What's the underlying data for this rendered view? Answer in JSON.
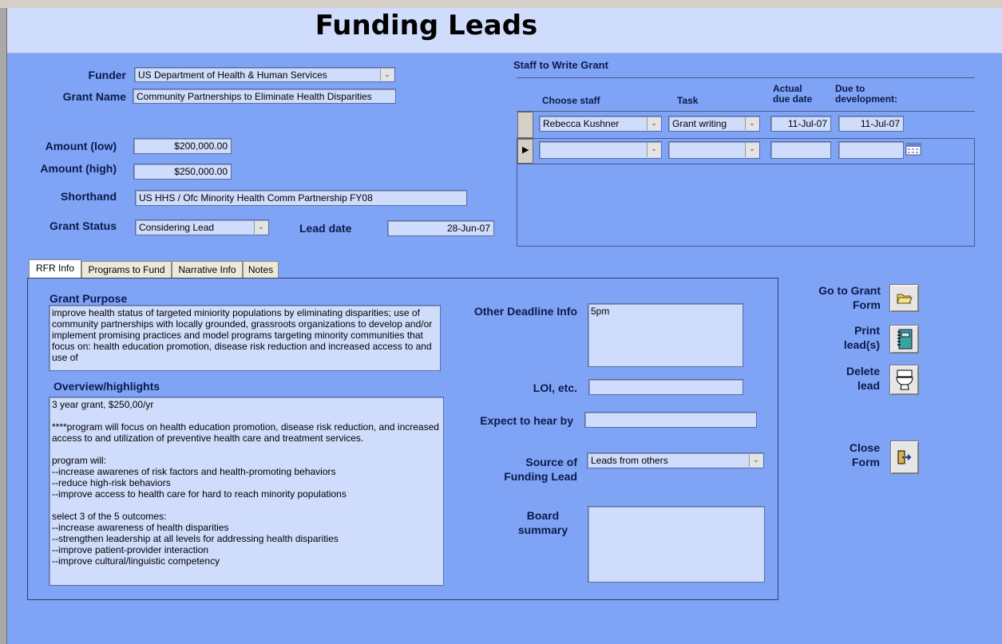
{
  "title": "Funding Leads",
  "labels": {
    "funder": "Funder",
    "grant_name": "Grant Name",
    "amount_low": "Amount (low)",
    "amount_high": "Amount (high)",
    "shorthand": "Shorthand",
    "grant_status": "Grant Status",
    "lead_date": "Lead date",
    "grant_purpose": "Grant Purpose",
    "overview": "Overview/highlights",
    "other_deadline": "Other Deadline Info",
    "loi": "LOI, etc.",
    "expect_hear": "Expect to hear by",
    "source_line1": "Source of",
    "source_line2": "Funding Lead",
    "board_line1": "Board",
    "board_line2": "summary"
  },
  "fields": {
    "funder": "US Department of Health & Human Services",
    "grant_name": "Community Partnerships to Eliminate Health Disparities",
    "amount_low": "$200,000.00",
    "amount_high": "$250,000.00",
    "shorthand": "US HHS / Ofc Minority Health Comm Partnership FY08",
    "grant_status": "Considering Lead",
    "lead_date": "28-Jun-07",
    "grant_purpose": "improve health status of targeted miniority populations by eliminating disparities; use of community partnerships with locally grounded, grassroots organizations to develop and/or implement promising practices and model programs targeting minority communities that focus on: health education promotion, disease risk reduction and increased access to and use of",
    "overview_lines": [
      "3 year grant, $250,00/yr",
      "",
      "****program will focus on health education promotion, disease risk reduction, and increased access to and utilization of preventive health care and treatment services.",
      "",
      "program will:",
      "--increase awarenes of risk factors and health-promoting behaviors",
      "--reduce high-risk behaviors",
      "--improve access to health care for hard to reach minority populations",
      "",
      "select 3 of the 5 outcomes:",
      "--increase awareness of health disparities",
      "--strengthen leadership at all levels for addressing health disparities",
      "--improve patient-provider interaction",
      "--improve cultural/linguistic competency"
    ],
    "other_deadline": "5pm",
    "loi": "",
    "expect_hear": "",
    "source": "Leads from others",
    "board_summary": ""
  },
  "staff": {
    "heading": "Staff to Write Grant",
    "columns": {
      "choose_staff": "Choose staff",
      "task": "Task",
      "actual_line1": "Actual",
      "actual_line2": "due date",
      "due_line1": "Due to",
      "due_line2": "development:"
    },
    "rows": [
      {
        "staff": "Rebecca Kushner",
        "task": "Grant writing",
        "actual": "11-Jul-07",
        "due": "11-Jul-07"
      }
    ]
  },
  "tabs": [
    "RFR Info",
    "Programs to Fund",
    "Narrative Info",
    "Notes"
  ],
  "buttons": {
    "go_line1": "Go to Grant",
    "go_line2": "Form",
    "print_line1": "Print",
    "print_line2": "lead(s)",
    "delete_line1": "Delete",
    "delete_line2": "lead",
    "close_line1": "Close",
    "close_line2": "Form"
  },
  "icons": {
    "go": "folder-open-icon",
    "print": "notebook-icon",
    "delete": "toilet-icon",
    "close": "door-exit-icon",
    "calendar": "calendar-icon",
    "dropdown": "chevron-down-icon",
    "record": "record-pointer-icon"
  },
  "colors": {
    "form_bg": "#7fa3f5",
    "header_bg": "#cfdcfb",
    "field_bg": "#cfdcfb"
  }
}
